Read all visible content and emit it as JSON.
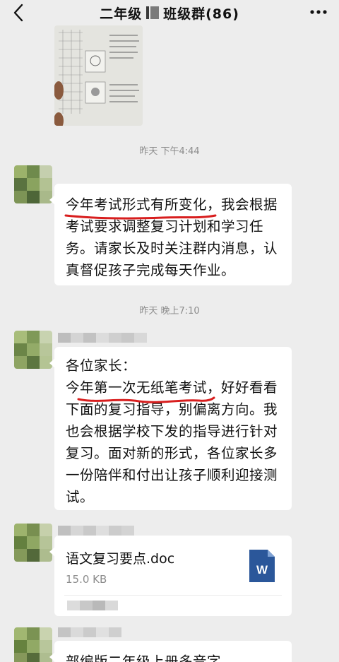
{
  "header": {
    "title_prefix": "二年级",
    "title_suffix": "班级群(86)",
    "back_icon": "chevron-left-icon",
    "more_icon": "more-dots-icon"
  },
  "timestamps": [
    "昨天 下午4:44",
    "昨天 晚上7:10"
  ],
  "messages": [
    {
      "type": "text",
      "lines": [
        "今年考试形式有所变化，我会根据",
        "考试要求调整复习计划和学习任",
        "务。请家长及时关注群内消息，认",
        "真督促孩子完成每天作业。"
      ]
    },
    {
      "type": "text",
      "lines": [
        "各位家长：",
        "今年第一次无纸笔考试，好好看看",
        "下面的复习指导，别偏离方向。我",
        "也会根据学校下发的指导进行针对",
        "复习。面对新的形式，各位家长多",
        "一份陪伴和付出让孩子顺利迎接测",
        "试。"
      ]
    },
    {
      "type": "file",
      "file_name": "语文复习要点.doc",
      "file_size": "15.0 KB",
      "icon": "word-document-icon",
      "icon_letter": "W",
      "icon_color": "#2b579a"
    },
    {
      "type": "text",
      "partial_text": "部编版二年级上册多音字"
    }
  ],
  "colors": {
    "background": "#ededed",
    "bubble": "#ffffff",
    "underline": "#d81e1e",
    "timestamp": "#8c8c8c"
  }
}
